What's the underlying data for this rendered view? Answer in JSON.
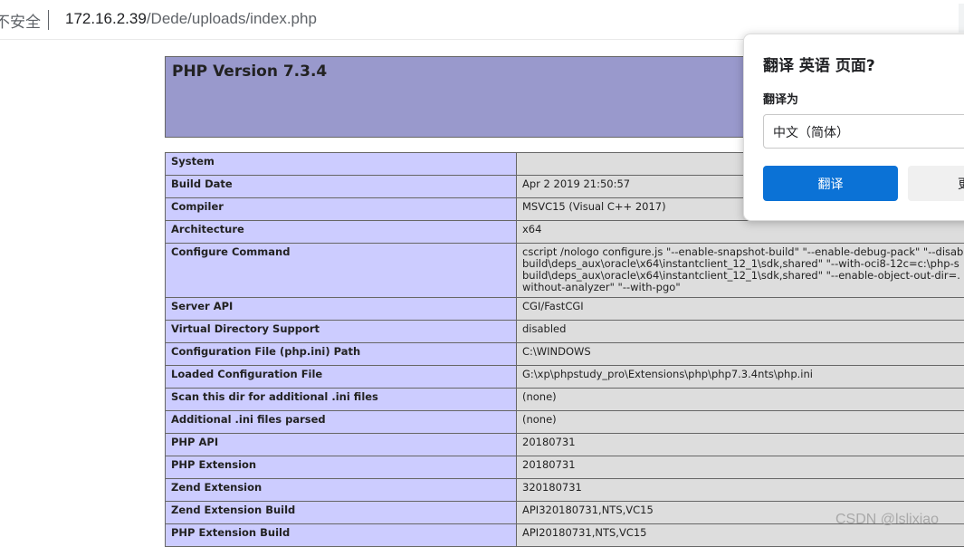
{
  "address_bar": {
    "security_label": "不安全",
    "url_host": "172.16.2.39",
    "url_path": "/Dede/uploads/index.php"
  },
  "phpinfo": {
    "version_title": "PHP Version 7.3.4",
    "rows": [
      {
        "key": "System",
        "value": ""
      },
      {
        "key": "Build Date",
        "value": "Apr 2 2019 21:50:57"
      },
      {
        "key": "Compiler",
        "value": "MSVC15 (Visual C++ 2017)"
      },
      {
        "key": "Architecture",
        "value": "x64"
      },
      {
        "key": "Configure Command",
        "value": "cscript /nologo configure.js \"--enable-snapshot-build\" \"--enable-debug-pack\" \"--disab\nbuild\\deps_aux\\oracle\\x64\\instantclient_12_1\\sdk,shared\" \"--with-oci8-12c=c:\\php-s\nbuild\\deps_aux\\oracle\\x64\\instantclient_12_1\\sdk,shared\" \"--enable-object-out-dir=.\nwithout-analyzer\" \"--with-pgo\""
      },
      {
        "key": "Server API",
        "value": "CGI/FastCGI"
      },
      {
        "key": "Virtual Directory Support",
        "value": "disabled"
      },
      {
        "key": "Configuration File (php.ini) Path",
        "value": "C:\\WINDOWS"
      },
      {
        "key": "Loaded Configuration File",
        "value": "G:\\xp\\phpstudy_pro\\Extensions\\php\\php7.3.4nts\\php.ini"
      },
      {
        "key": "Scan this dir for additional .ini files",
        "value": "(none)"
      },
      {
        "key": "Additional .ini files parsed",
        "value": "(none)"
      },
      {
        "key": "PHP API",
        "value": "20180731"
      },
      {
        "key": "PHP Extension",
        "value": "20180731"
      },
      {
        "key": "Zend Extension",
        "value": "320180731"
      },
      {
        "key": "Zend Extension Build",
        "value": "API320180731,NTS,VC15"
      },
      {
        "key": "PHP Extension Build",
        "value": "API20180731,NTS,VC15"
      }
    ]
  },
  "translate_popup": {
    "title": "翻译 英语 页面?",
    "translate_to_label": "翻译为",
    "selected_language": "中文（简体）",
    "translate_button": "翻译",
    "more_button": "更"
  },
  "watermark": "CSDN @lslixiao"
}
